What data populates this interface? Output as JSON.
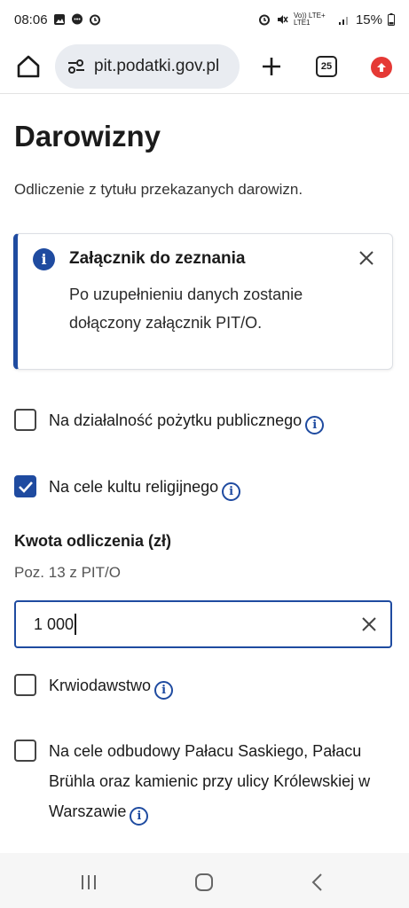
{
  "status_bar": {
    "time": "08:06",
    "network": "Vo)) LTE+ LTE1",
    "battery": "15%"
  },
  "browser": {
    "url": "pit.podatki.gov.pl",
    "tab_count": "25"
  },
  "page": {
    "title": "Darowizny",
    "description": "Odliczenie z tytułu przekazanych darowizn."
  },
  "info_box": {
    "title": "Załącznik do zeznania",
    "text": "Po uzupełnieniu danych zostanie dołączony załącznik PIT/O."
  },
  "options": [
    {
      "label": "Na działalność pożytku publicznego",
      "checked": false
    },
    {
      "label": "Na cele kultu religijnego",
      "checked": true
    },
    {
      "label": "Krwiodawstwo",
      "checked": false
    },
    {
      "label": "Na cele odbudowy Pałacu Saskiego, Pałacu Brühla oraz kamienic przy ulicy Królewskiej w Warszawie",
      "checked": false
    }
  ],
  "amount": {
    "label": "Kwota odliczenia (zł)",
    "hint": "Poz. 13 z PIT/O",
    "value": "1 000"
  },
  "colors": {
    "accent": "#1f4ba0",
    "update_badge": "#e53935"
  }
}
